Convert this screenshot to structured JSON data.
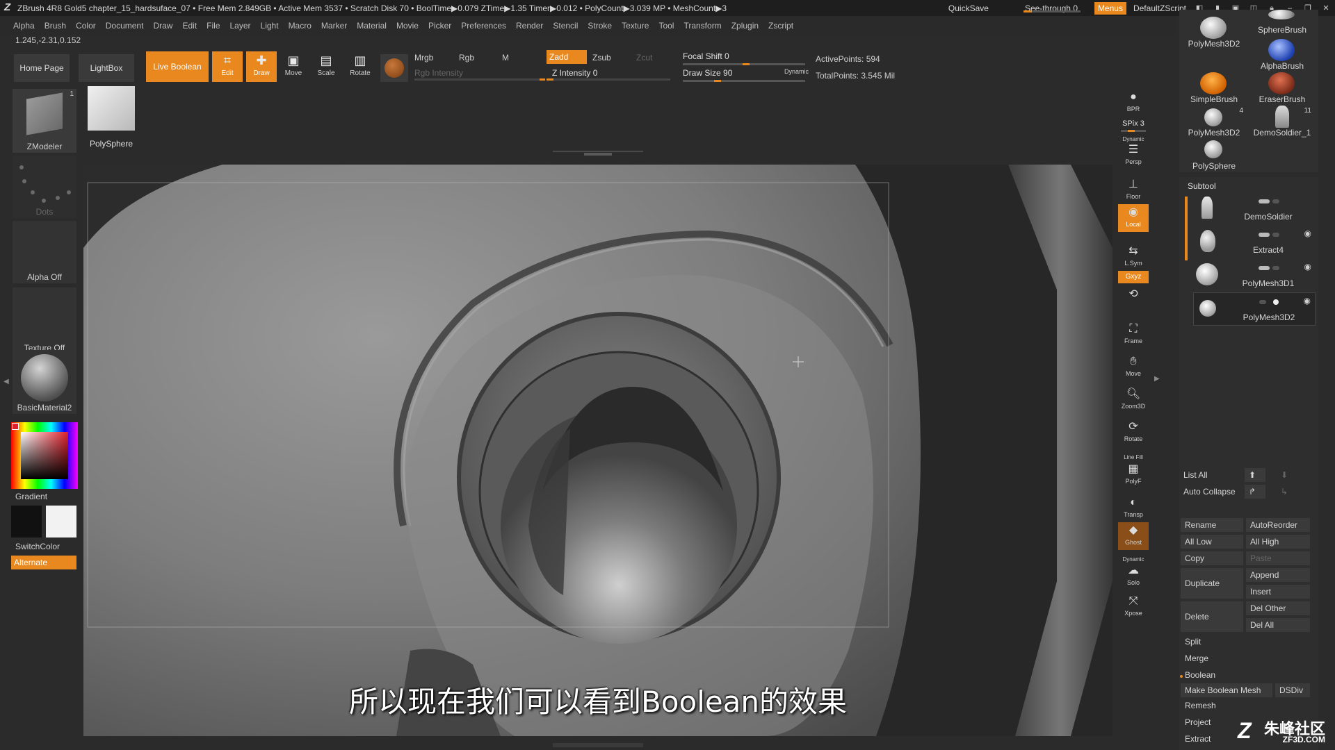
{
  "titlebar": {
    "text": "ZBrush 4R8 Gold5   chapter_15_hardsuface_07    • Free Mem 2.849GB • Active Mem 3537 • Scratch Disk 70 •  BoolTime▶0.079 ZTime▶1.35 Timer▶0.012 • PolyCount▶3.039 MP • MeshCount▶3",
    "quicksave": "QuickSave",
    "seethrough": "See-through  0",
    "menus": "Menus",
    "default_zscript": "DefaultZScript",
    "seethrough_level": 0
  },
  "menubar": [
    "Alpha",
    "Brush",
    "Color",
    "Document",
    "Draw",
    "Edit",
    "File",
    "Layer",
    "Light",
    "Macro",
    "Marker",
    "Material",
    "Movie",
    "Picker",
    "Preferences",
    "Render",
    "Stencil",
    "Stroke",
    "Texture",
    "Tool",
    "Transform",
    "Zplugin",
    "Zscript"
  ],
  "coords": "1.245,-2.31,0.152",
  "toolbar": {
    "home_page": "Home Page",
    "lightbox": "LightBox",
    "live_boolean": "Live Boolean",
    "edit": "Edit",
    "draw": "Draw",
    "move": "Move",
    "scale": "Scale",
    "rotate": "Rotate",
    "mrgb": "Mrgb",
    "rgb": "Rgb",
    "m": "M",
    "rgb_intensity": "Rgb Intensity",
    "zadd": "Zadd",
    "zsub": "Zsub",
    "zcut": "Zcut",
    "z_intensity": "Z Intensity 0",
    "focal_shift": "Focal Shift 0",
    "draw_size": "Draw Size 90",
    "dynamic": "Dynamic",
    "active_points": "ActivePoints: 594",
    "total_points": "TotalPoints: 3.545 Mil",
    "accent_color": "#e8881f"
  },
  "leftshelf": {
    "current_tool": "ZModeler",
    "current_tool_count": "1",
    "last_tool": "PolySphere",
    "stroke": "Dots",
    "alpha": "Alpha Off",
    "texture": "Texture Off",
    "material": "BasicMaterial2",
    "gradient": "Gradient",
    "switchcolor": "SwitchColor",
    "alternate": "Alternate",
    "main_color": "#111111",
    "secondary_color": "#f2f2f2"
  },
  "viewport": {
    "subtitle": "所以现在我们可以看到Boolean的效果"
  },
  "rightbar": {
    "bpr": "BPR",
    "spix": "SPix 3",
    "dynamic": "Dynamic",
    "persp": "Persp",
    "floor": "Floor",
    "local": "Local",
    "lsym": "L.Sym",
    "xyz": "Gxyz",
    "frame": "Frame",
    "move": "Move",
    "zoom3d": "Zoom3D",
    "rotate": "Rotate",
    "line_fill": "Line Fill",
    "polyf": "PolyF",
    "transp": "Transp",
    "ghost": "Ghost",
    "solo_dynamic": "Dynamic",
    "solo": "Solo",
    "xpose": "Xpose"
  },
  "tool_palette": {
    "items": [
      {
        "label": "PolyMesh3D2",
        "icon": "sphere-icon"
      },
      {
        "label": "SphereBrush",
        "icon": "sphere-icon"
      },
      {
        "label": "AlphaBrush",
        "icon": "alpha-brush-icon"
      },
      {
        "label": "SimpleBrush",
        "icon": "simple-brush-icon"
      },
      {
        "label": "EraserBrush",
        "icon": "eraser-brush-icon"
      },
      {
        "label": "PolyMesh3D2",
        "icon": "sphere-icon",
        "count": "4"
      },
      {
        "label": "DemoSoldier_1",
        "icon": "soldier-icon",
        "count": "11"
      },
      {
        "label": "PolySphere",
        "icon": "sphere-icon"
      }
    ]
  },
  "subtool": {
    "title": "Subtool",
    "items": [
      {
        "name": "DemoSoldier"
      },
      {
        "name": "Extract4"
      },
      {
        "name": "PolyMesh3D1"
      },
      {
        "name": "PolyMesh3D2"
      }
    ],
    "list_all": "List All",
    "auto_collapse": "Auto Collapse",
    "rename": "Rename",
    "autoreorder": "AutoReorder",
    "all_low": "All Low",
    "all_high": "All High",
    "copy": "Copy",
    "paste": "Paste",
    "duplicate": "Duplicate",
    "append": "Append",
    "insert": "Insert",
    "delete": "Delete",
    "del_other": "Del Other",
    "del_all": "Del All",
    "split": "Split",
    "merge": "Merge",
    "boolean": "Boolean",
    "make_boolean_mesh": "Make Boolean Mesh",
    "dsdiv": "DSDiv",
    "remesh": "Remesh",
    "project": "Project",
    "extract": "Extract"
  },
  "watermark": {
    "name": "朱峰社区",
    "site": "ZF3D.COM"
  }
}
